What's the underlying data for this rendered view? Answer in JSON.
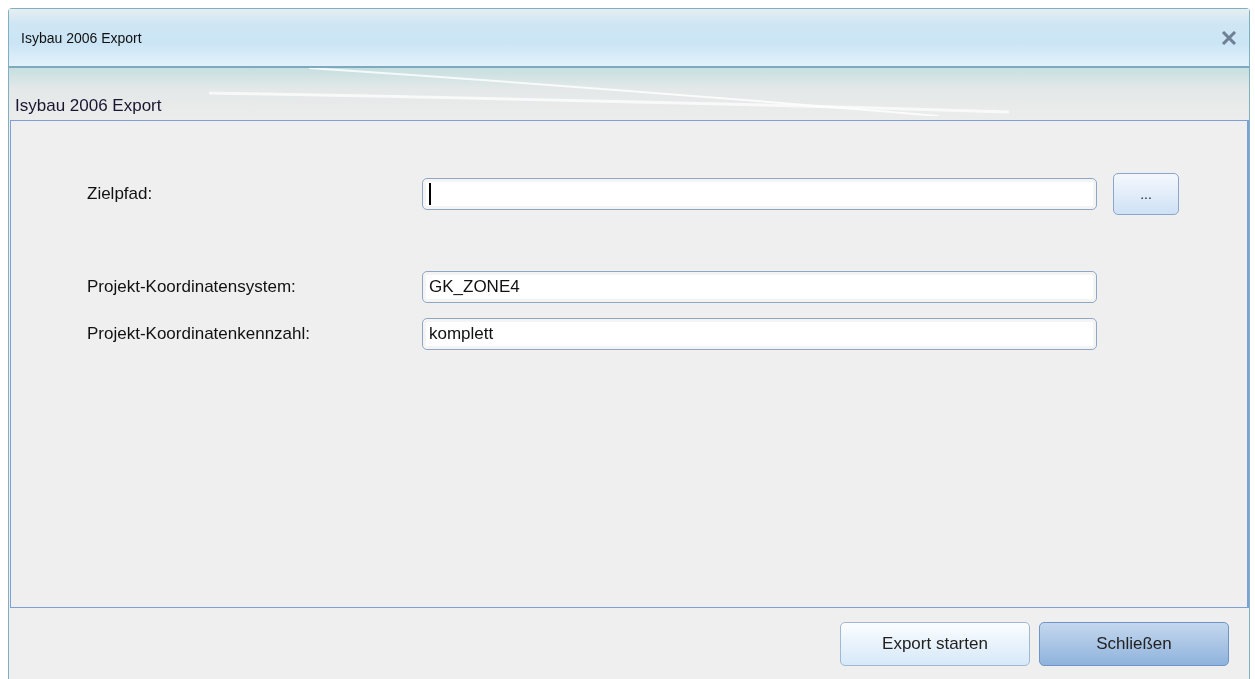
{
  "window": {
    "title": "Isybau 2006 Export"
  },
  "header": {
    "title": "Isybau 2006 Export"
  },
  "fields": [
    {
      "label": "Zielpfad:",
      "focused": true,
      "browse_button": "..."
    },
    {
      "label": "Projekt-Koordinatensystem:",
      "value": "GK_ZONE4",
      "focused": false
    },
    {
      "label": "Projekt-Koordinatenkennzahl:",
      "value": "komplett",
      "focused": false
    }
  ],
  "buttons": [
    {
      "label": "Export starten",
      "default": false
    },
    {
      "label": "Schließen",
      "default": true
    }
  ]
}
